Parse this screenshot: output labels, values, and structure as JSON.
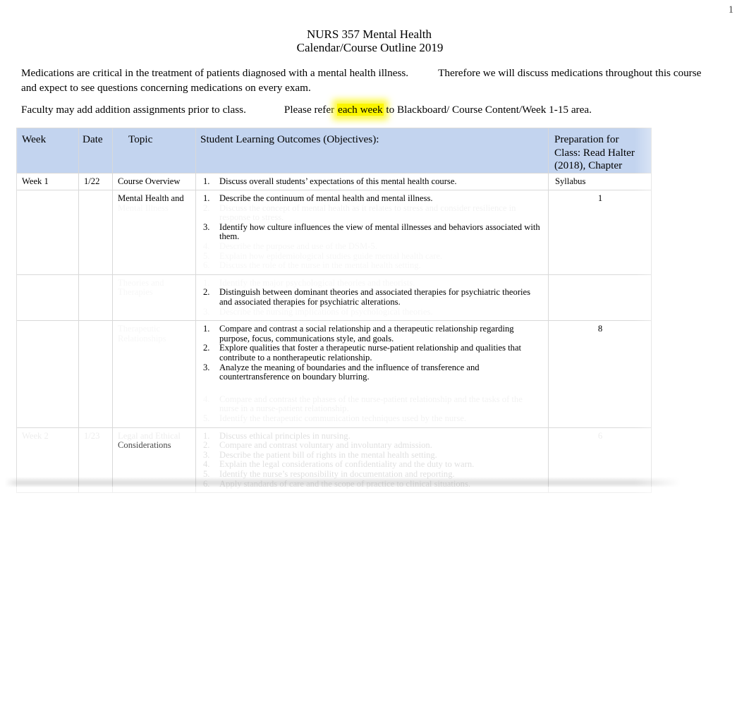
{
  "page": {
    "number": "1",
    "title_line_1": "NURS 357 Mental Health",
    "title_line_2": "Calendar/Course Outline 2019"
  },
  "intro": {
    "paragraph_1_part_1": "Medications are critical in the treatment of patients diagnosed with a mental health illness.",
    "paragraph_1_part_2": "Therefore we will discuss medications throughout this course and expect to see questions concerning medications on every exam.",
    "paragraph_2_part_1": "Faculty may add addition assignments prior to class.",
    "paragraph_2_part_2": "Please refer",
    "paragraph_2_highlight": "each week",
    "paragraph_2_part_3": "to Blackboard/ Course Content/Week 1-15 area."
  },
  "table": {
    "headers": {
      "week": "Week",
      "date": "Date",
      "topic": "Topic",
      "slo": "Student Learning Outcomes (Objectives):",
      "prep": "Preparation for Class: Read Halter (2018), Chapter"
    },
    "rows": [
      {
        "week": "Week 1",
        "date": "1/22",
        "topic": "Course Overview",
        "prep": "Syllabus",
        "objectives": [
          {
            "num": "1.",
            "text": "Discuss overall students’ expectations of this mental health course."
          }
        ]
      },
      {
        "week": "",
        "date": "",
        "topic": "Mental Health and",
        "topic_faded": "Mental Illness",
        "prep": "1",
        "objectives": [
          {
            "num": "1.",
            "text": "Describe the continuum of mental health and mental illness."
          },
          {
            "num": "2.",
            "text": "Discuss the concept of mental health as it relates to stress and consider resilience in response to stress.",
            "faded": "partial"
          },
          {
            "num": "3.",
            "text": "Identify how culture influences the view of mental illnesses and behaviors associated with them."
          },
          {
            "num": "4.",
            "text": "Describe the purpose and use of the DSM-5.",
            "faded": "full"
          },
          {
            "num": "5.",
            "text": "Explain how epidemiological studies guide mental health care.",
            "faded": "full"
          },
          {
            "num": "6.",
            "text": "Discuss the role of the nurse in the mental health setting.",
            "faded": "full"
          }
        ]
      },
      {
        "week": "",
        "date": "",
        "topic": "Theories and Therapies",
        "topic_faded": "full",
        "prep": "",
        "objectives": [
          {
            "num": "1.",
            "text": "Identify the major psychological theories and theorists.",
            "faded": "full"
          },
          {
            "num": "2.",
            "text": "Distinguish between dominant theories and associated therapies for psychiatric theories and associated therapies for psychiatric alterations."
          },
          {
            "num": "3.",
            "text": "Describe the nursing implications of psychological theories.",
            "faded": "full"
          }
        ]
      },
      {
        "week": "",
        "date": "",
        "topic": "Therapeutic Relationships",
        "topic_faded": "full",
        "prep": "8",
        "objectives": [
          {
            "num": "1.",
            "text": "Compare and contrast a social relationship and a therapeutic relationship regarding purpose, focus, communications style, and goals."
          },
          {
            "num": "2.",
            "text": "Explore qualities that foster a therapeutic nurse-patient relationship and qualities that contribute to a nontherapeutic relationship."
          },
          {
            "num": "3.",
            "text": "Analyze the meaning of boundaries and the influence of transference and countertransference on boundary blurring."
          },
          {
            "num": "4.",
            "text": "Compare and contrast the phases of the nurse-patient relationship and the tasks of the nurse in a nurse-patient relationship.",
            "faded": "partial"
          },
          {
            "num": "5.",
            "text": "Identify the therapeutic communication techniques used by the nurse.",
            "faded": "full"
          }
        ]
      },
      {
        "week": "Week 2",
        "date": "1/23",
        "topic": "Legal and Ethical",
        "topic_line_2": "Considerations",
        "prep": "6",
        "faded": true,
        "objectives": [
          {
            "num": "1.",
            "text": "Discuss ethical principles in nursing.",
            "faded": "full"
          },
          {
            "num": "2.",
            "text": "Compare and contrast voluntary and involuntary admission.",
            "faded": "full"
          },
          {
            "num": "3.",
            "text": "Describe the patient bill of rights in the mental health setting.",
            "faded": "full"
          },
          {
            "num": "4.",
            "text": "Explain the legal considerations of confidentiality and the duty to warn.",
            "faded": "full"
          },
          {
            "num": "5.",
            "text": "Identify the nurse’s responsibility in documentation and reporting.",
            "faded": "full"
          },
          {
            "num": "6.",
            "text": "Apply standards of care and the scope of practice to clinical situations.",
            "faded": "full"
          }
        ]
      }
    ]
  },
  "colors": {
    "header_background": "#c3d4ef",
    "highlight": "#fbf500",
    "border": "#d9d9d9",
    "text": "#000000"
  }
}
